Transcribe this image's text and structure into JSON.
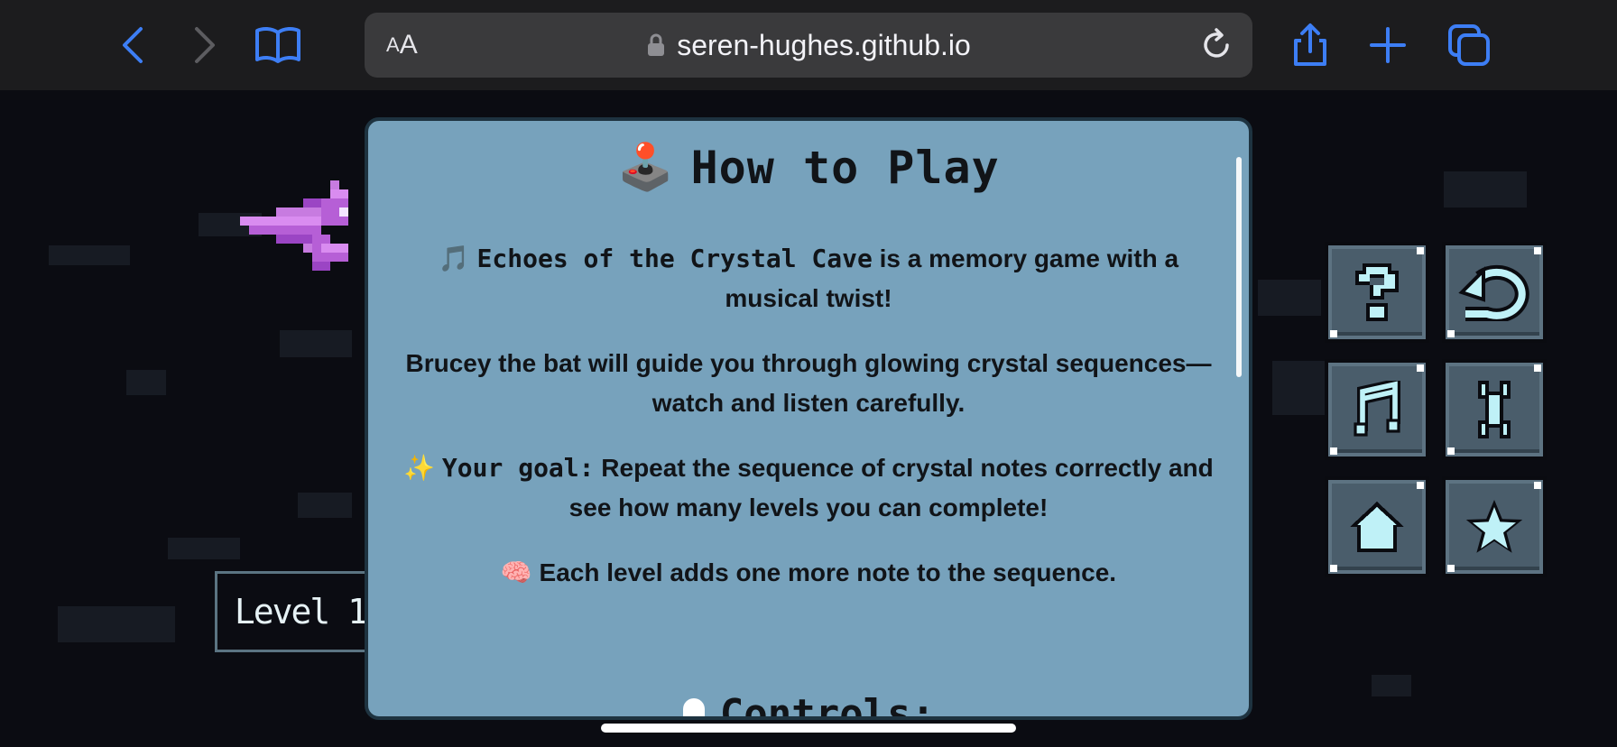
{
  "browser": {
    "text_size_label_small": "A",
    "text_size_label_big": "A",
    "url": "seren-hughes.github.io",
    "accent_color": "#3d7ef5"
  },
  "game": {
    "level_label": "Level 1",
    "tiles": [
      {
        "icon": "question-icon"
      },
      {
        "icon": "replay-icon"
      },
      {
        "icon": "music-note-icon"
      },
      {
        "icon": "wrench-icon"
      },
      {
        "icon": "home-icon"
      },
      {
        "icon": "star-icon"
      }
    ]
  },
  "modal": {
    "title_emoji": "🕹️",
    "title": "How to Play",
    "intro_emoji": "🎵",
    "intro_bold": "Echoes of the Crystal Cave",
    "intro_rest": " is a memory game with a musical twist!",
    "guide": "Brucey the bat will guide you through glowing crystal sequences—watch and listen carefully.",
    "goal_emoji": "✨",
    "goal_bold": "Your goal:",
    "goal_rest": " Repeat the sequence of crystal notes correctly and see how many levels you can complete!",
    "level_emoji": "🧠",
    "level_text": " Each level adds one more note to the sequence.",
    "controls_heading": "Controls:"
  }
}
